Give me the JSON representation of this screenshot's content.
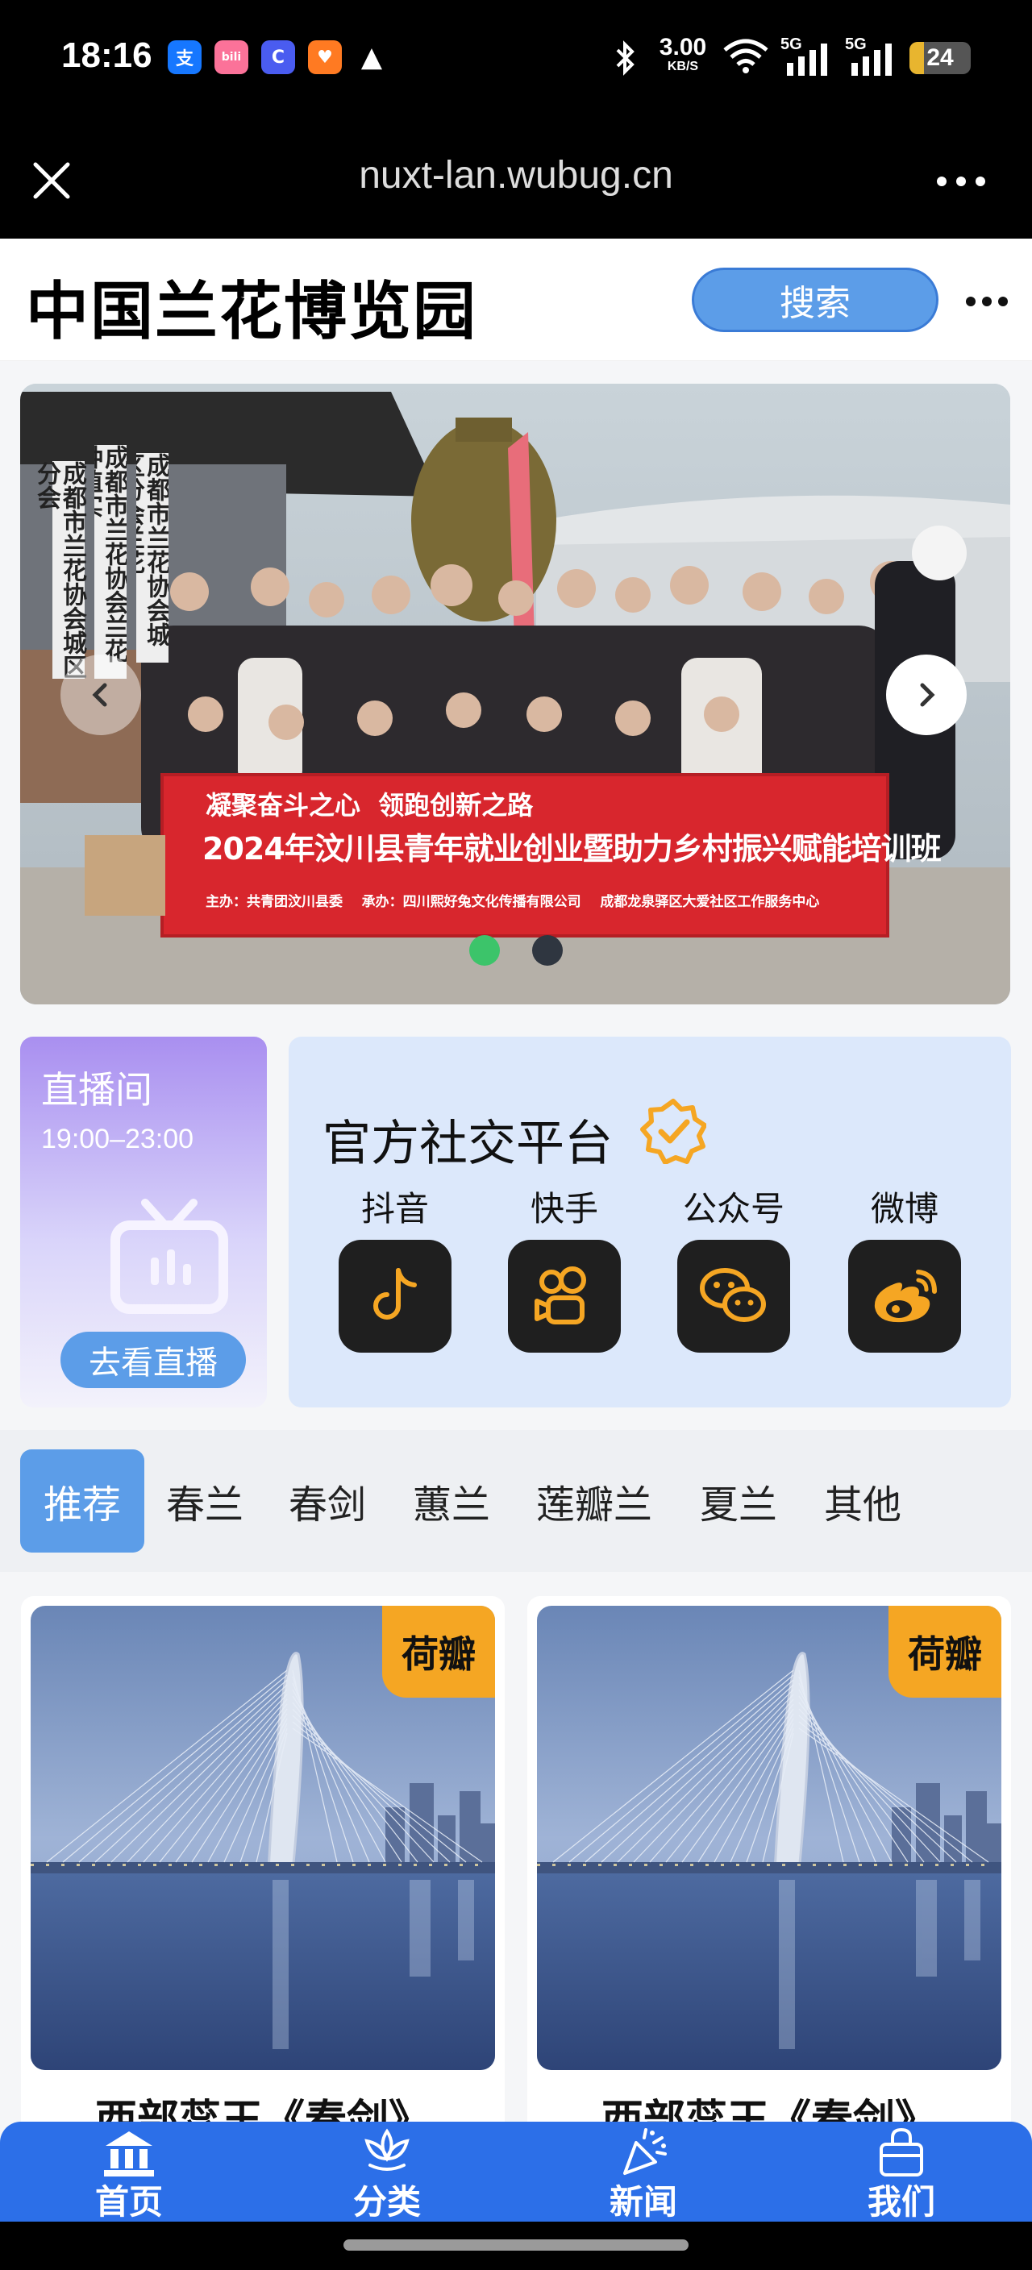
{
  "status_bar": {
    "time": "18:16",
    "app_icons": [
      {
        "name": "alipay-icon",
        "glyph": "支",
        "color": "#1677ff"
      },
      {
        "name": "bilibili-icon",
        "glyph": "bili",
        "color": "#fb7299"
      },
      {
        "name": "browser-app-icon",
        "glyph": "C",
        "color": "#4a5cf0"
      },
      {
        "name": "health-app-icon",
        "glyph": "♥",
        "color": "#ff7a22"
      },
      {
        "name": "warning-icon",
        "glyph": "▲",
        "color": "#000000"
      }
    ],
    "net_speed_value": "3.00",
    "net_speed_unit": "KB/S",
    "signal_1_label": "5G",
    "signal_2_label": "5G",
    "battery": "24",
    "battery_level": 0.24
  },
  "browser": {
    "url": "nuxt-lan.wubug.cn"
  },
  "header": {
    "logo": "中国兰花博览园",
    "search_label": "搜索"
  },
  "carousel": {
    "slide_count": 2,
    "active_index": 0,
    "banner_line1": "凝聚奋斗之心  领跑创新之路",
    "banner_line2": "2024年汶川县青年就业创业暨助力乡村振兴赋能培训班",
    "banner_line3": "主办：共青团汶川县委    承办：四川熙好兔文化传播有限公司    成都龙泉驿区大爱社区工作服务中心",
    "signs": [
      "成都市兰花协会城区分会",
      "成都市兰花协会兰花种植实",
      "成都市兰花协会城区分会兰花"
    ]
  },
  "live": {
    "title": "直播间",
    "time": "19:00–23:00",
    "button": "去看直播"
  },
  "social": {
    "title": "官方社交平台",
    "platforms": [
      {
        "label": "抖音",
        "icon": "douyin-icon"
      },
      {
        "label": "快手",
        "icon": "kuaishou-icon"
      },
      {
        "label": "公众号",
        "icon": "wechat-icon"
      },
      {
        "label": "微博",
        "icon": "weibo-icon"
      }
    ]
  },
  "tabs": {
    "items": [
      "推荐",
      "春兰",
      "春剑",
      "蕙兰",
      "莲瓣兰",
      "夏兰",
      "其他"
    ],
    "active": 0
  },
  "products": [
    {
      "badge": "荷瓣",
      "title": "西部蕊王《春剑》"
    },
    {
      "badge": "荷瓣",
      "title": "西部蕊王《春剑》"
    }
  ],
  "nav": {
    "items": [
      {
        "label": "首页",
        "icon": "home-icon"
      },
      {
        "label": "分类",
        "icon": "category-icon"
      },
      {
        "label": "新闻",
        "icon": "news-icon"
      },
      {
        "label": "我们",
        "icon": "about-us-icon"
      }
    ]
  },
  "colors": {
    "accent": "#5c9de8",
    "nav_blue": "#2c6fe8",
    "badge_orange": "#f5a623",
    "live_purple": "#a98ff0",
    "social_bg": "#dce8fb"
  }
}
